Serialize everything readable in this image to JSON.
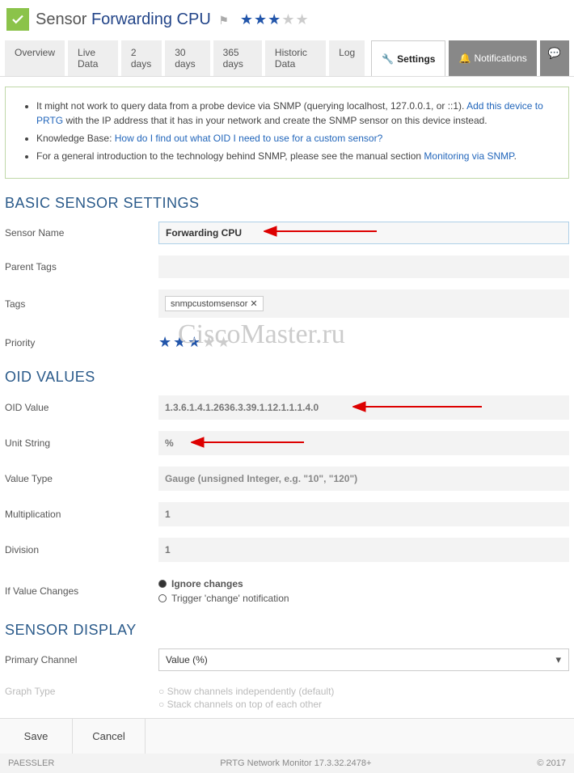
{
  "header": {
    "prefix": "Sensor",
    "name": "Forwarding CPU",
    "stars_filled": 3,
    "stars_total": 5
  },
  "tabs": {
    "overview": "Overview",
    "live": "Live Data",
    "d2": "2 days",
    "d30": "30 days",
    "d365": "365 days",
    "historic": "Historic Data",
    "log": "Log",
    "settings": "Settings",
    "notifications": "Notifications"
  },
  "info": {
    "line1a": "It might not work to query data from a probe device via SNMP (querying localhost, 127.0.0.1, or ::1). ",
    "line1_link": "Add this device to PRTG",
    "line1b": " with the IP address that it has in your network and create the SNMP sensor on this device instead.",
    "line2a": "Knowledge Base: ",
    "line2_link": "How do I find out what OID I need to use for a custom sensor?",
    "line3a": "For a general introduction to the technology behind SNMP, please see the manual section ",
    "line3_link": "Monitoring via SNMP",
    "line3b": "."
  },
  "sections": {
    "basic": "BASIC SENSOR SETTINGS",
    "oid": "OID VALUES",
    "display": "SENSOR DISPLAY"
  },
  "labels": {
    "sensor_name": "Sensor Name",
    "parent_tags": "Parent Tags",
    "tags": "Tags",
    "priority": "Priority",
    "oid_value": "OID Value",
    "unit_string": "Unit String",
    "value_type": "Value Type",
    "multiplication": "Multiplication",
    "division": "Division",
    "if_changes": "If Value Changes",
    "primary_channel": "Primary Channel",
    "graph_type": "Graph Type"
  },
  "values": {
    "sensor_name": "Forwarding CPU",
    "tag1": "snmpcustomsensor",
    "oid_value": "1.3.6.1.4.1.2636.3.39.1.12.1.1.1.4.0",
    "unit_string": "%",
    "value_type": "Gauge (unsigned Integer, e.g. \"10\", \"120\")",
    "multiplication": "1",
    "division": "1",
    "ignore": "Ignore changes",
    "trigger": "Trigger 'change' notification",
    "primary_channel": "Value (%)",
    "ghost1": "Show channels independently (default)",
    "ghost2": "Stack channels on top of each other"
  },
  "buttons": {
    "save": "Save",
    "cancel": "Cancel"
  },
  "footer": {
    "left": "PAESSLER",
    "center": "PRTG Network Monitor 17.3.32.2478+",
    "right": "© 2017"
  },
  "watermark": "CiscoMaster.ru"
}
